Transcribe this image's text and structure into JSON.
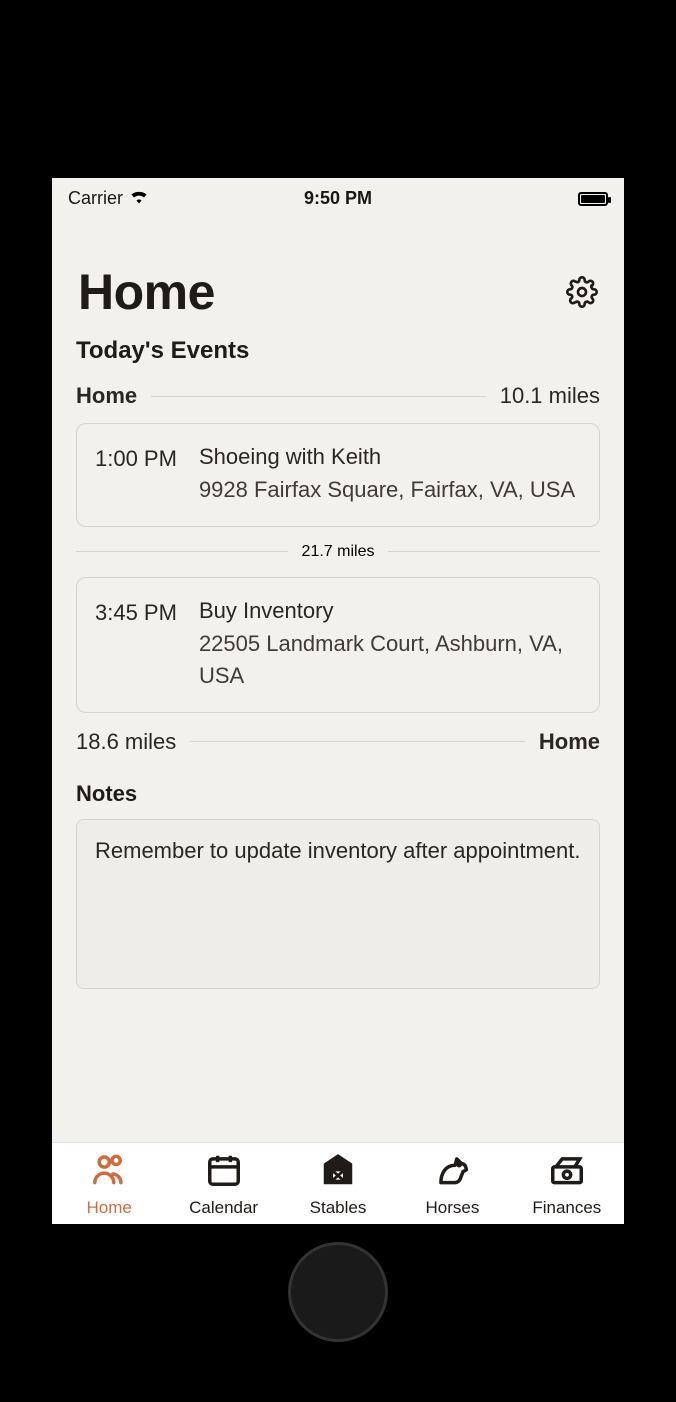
{
  "status": {
    "carrier": "Carrier",
    "time": "9:50 PM"
  },
  "header": {
    "title": "Home"
  },
  "events": {
    "section_title": "Today's Events",
    "start_label": "Home",
    "start_distance": "10.1 miles",
    "middle_distance": "21.7 miles",
    "end_distance": "18.6 miles",
    "end_label": "Home",
    "items": [
      {
        "time": "1:00 PM",
        "title": "Shoeing with Keith",
        "location": "9928 Fairfax Square, Fairfax, VA, USA"
      },
      {
        "time": "3:45 PM",
        "title": "Buy Inventory",
        "location": "22505 Landmark Court, Ashburn, VA, USA"
      }
    ]
  },
  "notes": {
    "title": "Notes",
    "body": "Remember to update inventory after appointment."
  },
  "tabs": [
    {
      "label": "Home"
    },
    {
      "label": "Calendar"
    },
    {
      "label": "Stables"
    },
    {
      "label": "Horses"
    },
    {
      "label": "Finances"
    }
  ]
}
